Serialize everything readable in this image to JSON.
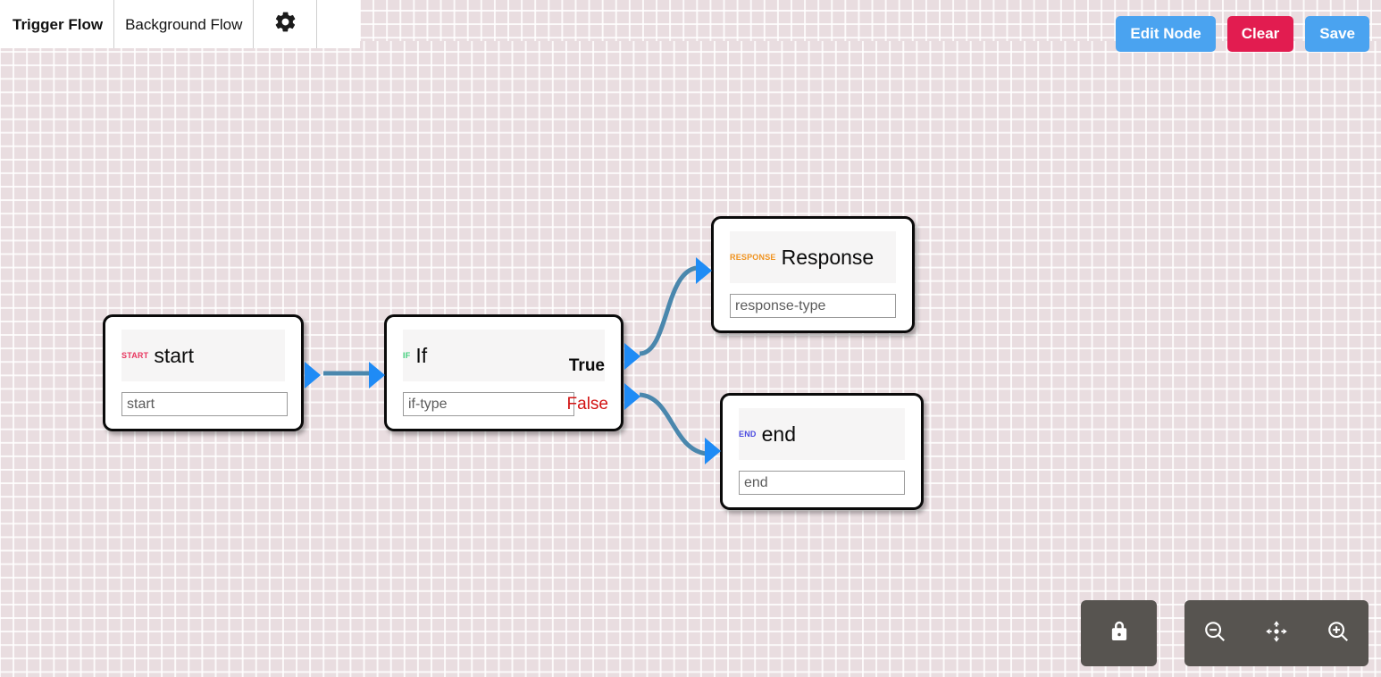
{
  "tabs": [
    {
      "label": "Trigger Flow",
      "active": true
    },
    {
      "label": "Background Flow",
      "active": false
    }
  ],
  "settings_icon": "gear-icon",
  "toolbar": {
    "edit_node_label": "Edit Node",
    "clear_label": "Clear",
    "save_label": "Save",
    "edit_node_color": "#4aa3f0",
    "clear_color": "#e21c50",
    "save_color": "#4aa3f0"
  },
  "canvas": {
    "background_color": "#e9dde0",
    "grid_line_color": "#ffffff",
    "edge_color": "#4a87ad",
    "handle_color": "#1f8bf5"
  },
  "nodes": [
    {
      "id": "start",
      "badge": "START",
      "badge_color": "#e8365f",
      "title": "start",
      "input_value": "start",
      "input_placeholder": "start"
    },
    {
      "id": "if",
      "badge": "IF",
      "badge_color": "#3ecf7a",
      "title": "If",
      "input_value": "if-type",
      "input_placeholder": "if-type",
      "branch_true": "True",
      "branch_true_color": "#0b0b0b",
      "branch_false": "False",
      "branch_false_color": "#d21414"
    },
    {
      "id": "response",
      "badge": "RESPONSE",
      "badge_color": "#f0931f",
      "title": "Response",
      "input_value": "response-type",
      "input_placeholder": "response-type"
    },
    {
      "id": "end",
      "badge": "END",
      "badge_color": "#4a4ae0",
      "title": "end",
      "input_value": "end",
      "input_placeholder": "end"
    }
  ],
  "controls": {
    "lock_icon": "lock-icon",
    "zoom_out_icon": "zoom-out-icon",
    "fit_view_icon": "fit-view-icon",
    "zoom_in_icon": "zoom-in-icon"
  }
}
